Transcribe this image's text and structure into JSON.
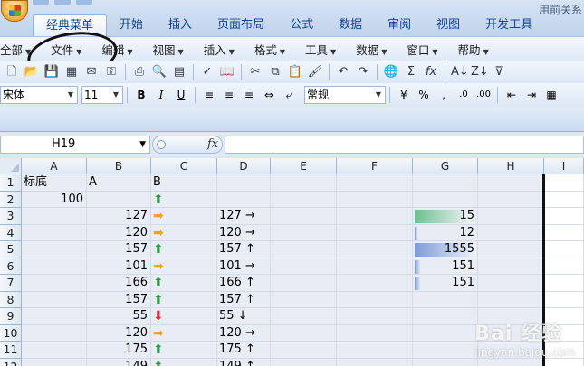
{
  "title": {
    "app_title": "用前关系"
  },
  "ribbon_tabs": [
    "经典菜单",
    "开始",
    "插入",
    "页面布局",
    "公式",
    "数据",
    "审阅",
    "视图",
    "开发工具"
  ],
  "menu": [
    "全部",
    "文件",
    "编辑",
    "视图",
    "插入",
    "格式",
    "工具",
    "数据",
    "窗口",
    "帮助"
  ],
  "font": {
    "name": "宋体",
    "size": "11",
    "number_format": "常规"
  },
  "name_box": "H19",
  "columns": [
    "A",
    "B",
    "C",
    "D",
    "E",
    "F",
    "G",
    "H",
    "I"
  ],
  "rows": [
    "1",
    "2",
    "3",
    "4",
    "5",
    "6",
    "7",
    "8",
    "9",
    "10",
    "11",
    "12"
  ],
  "cells": {
    "A1": "标底",
    "B1": "A",
    "C1": "B",
    "A2": "100",
    "B3": "127",
    "D3": "127 →",
    "G3": "15",
    "B4": "120",
    "D4": "120 →",
    "G4": "12",
    "B5": "157",
    "D5": "157 ↑",
    "G5": "1555",
    "B6": "101",
    "D6": "101 →",
    "G6": "151",
    "B7": "166",
    "D7": "166 ↑",
    "G7": "151",
    "B8": "157",
    "D8": "157 ↑",
    "B9": "55",
    "D9": "55 ↓",
    "B10": "120",
    "D10": "120 →",
    "B11": "175",
    "D11": "175 ↑",
    "B12": "149",
    "D12": "149 ↑"
  },
  "icon_set_column_C": [
    "up",
    "right",
    "right",
    "up",
    "right",
    "up",
    "up",
    "down",
    "right",
    "up",
    "up"
  ],
  "data_bars_G": [
    {
      "row": "3",
      "value": 15,
      "fill": 0.94,
      "color": "#6fbf8f"
    },
    {
      "row": "4",
      "value": 12,
      "fill": 0.04,
      "color": "#7d9bd6"
    },
    {
      "row": "5",
      "value": 1555,
      "fill": 1.0,
      "color": "#7d9bd6"
    },
    {
      "row": "6",
      "value": 151,
      "fill": 0.1,
      "color": "#7d9bd6"
    },
    {
      "row": "7",
      "value": 151,
      "fill": 0.1,
      "color": "#7d9bd6"
    }
  ],
  "watermark": {
    "text": "Bai 经验",
    "sub": "jingyan.baidu.com"
  },
  "colors": {
    "up": "#2e9d3d",
    "right": "#f2a51a",
    "down": "#d92c2c"
  }
}
